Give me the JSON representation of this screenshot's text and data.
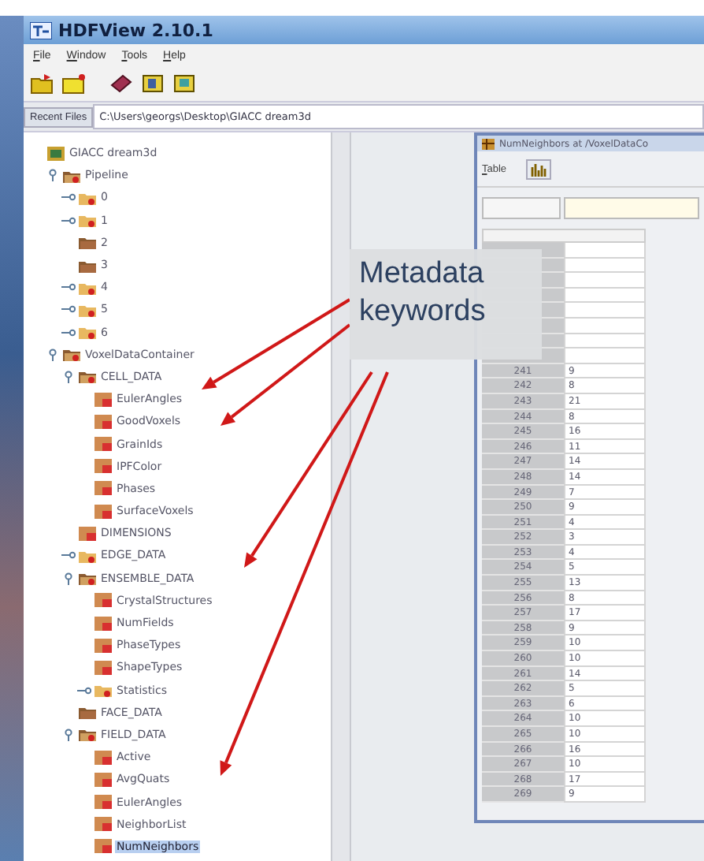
{
  "window": {
    "title": "HDFView 2.10.1"
  },
  "menu": [
    "File",
    "Window",
    "Tools",
    "Help"
  ],
  "recent_files": {
    "label": "Recent Files",
    "value": "C:\\Users\\georgs\\Desktop\\GIACC dream3d"
  },
  "tree": [
    {
      "label": "GIACC dream3d",
      "kind": "file",
      "selected": false,
      "children": [
        {
          "label": "Pipeline",
          "kind": "group",
          "expanded": true,
          "selected": false,
          "children": [
            {
              "label": "0",
              "kind": "group",
              "expanded": false,
              "selected": false
            },
            {
              "label": "1",
              "kind": "group",
              "expanded": false,
              "selected": false
            },
            {
              "label": "2",
              "kind": "empty_group",
              "selected": false
            },
            {
              "label": "3",
              "kind": "empty_group",
              "selected": false
            },
            {
              "label": "4",
              "kind": "group",
              "expanded": false,
              "selected": false
            },
            {
              "label": "5",
              "kind": "group",
              "expanded": false,
              "selected": false
            },
            {
              "label": "6",
              "kind": "group",
              "expanded": false,
              "selected": false
            }
          ]
        },
        {
          "label": "VoxelDataContainer",
          "kind": "group",
          "expanded": true,
          "selected": false,
          "children": [
            {
              "label": "CELL_DATA",
              "kind": "group",
              "expanded": true,
              "selected": false,
              "children": [
                {
                  "label": "EulerAngles",
                  "kind": "dataset",
                  "selected": false
                },
                {
                  "label": "GoodVoxels",
                  "kind": "dataset",
                  "selected": false
                },
                {
                  "label": "GrainIds",
                  "kind": "dataset",
                  "selected": false
                },
                {
                  "label": "IPFColor",
                  "kind": "dataset",
                  "selected": false
                },
                {
                  "label": "Phases",
                  "kind": "dataset",
                  "selected": false
                },
                {
                  "label": "SurfaceVoxels",
                  "kind": "dataset",
                  "selected": false
                }
              ]
            },
            {
              "label": "DIMENSIONS",
              "kind": "dataset",
              "selected": false
            },
            {
              "label": "EDGE_DATA",
              "kind": "group",
              "expanded": false,
              "selected": false
            },
            {
              "label": "ENSEMBLE_DATA",
              "kind": "group",
              "expanded": true,
              "selected": false,
              "children": [
                {
                  "label": "CrystalStructures",
                  "kind": "dataset",
                  "selected": false
                },
                {
                  "label": "NumFields",
                  "kind": "dataset",
                  "selected": false
                },
                {
                  "label": "PhaseTypes",
                  "kind": "dataset",
                  "selected": false
                },
                {
                  "label": "ShapeTypes",
                  "kind": "dataset",
                  "selected": false
                },
                {
                  "label": "Statistics",
                  "kind": "group",
                  "expanded": false,
                  "selected": false
                }
              ]
            },
            {
              "label": "FACE_DATA",
              "kind": "empty_group",
              "selected": false
            },
            {
              "label": "FIELD_DATA",
              "kind": "group",
              "expanded": true,
              "selected": false,
              "children": [
                {
                  "label": "Active",
                  "kind": "dataset",
                  "selected": false
                },
                {
                  "label": "AvgQuats",
                  "kind": "dataset",
                  "selected": false
                },
                {
                  "label": "EulerAngles",
                  "kind": "dataset",
                  "selected": false
                },
                {
                  "label": "NeighborList",
                  "kind": "dataset",
                  "selected": false
                },
                {
                  "label": "NumNeighbors",
                  "kind": "dataset",
                  "selected": true
                }
              ]
            }
          ]
        }
      ]
    }
  ],
  "table_window": {
    "title": "NumNeighbors  at  /VoxelDataCo",
    "menu": [
      "Table"
    ],
    "rows": [
      {
        "index": "241",
        "value": "9"
      },
      {
        "index": "242",
        "value": "8"
      },
      {
        "index": "243",
        "value": "21"
      },
      {
        "index": "244",
        "value": "8"
      },
      {
        "index": "245",
        "value": "16"
      },
      {
        "index": "246",
        "value": "11"
      },
      {
        "index": "247",
        "value": "14"
      },
      {
        "index": "248",
        "value": "14"
      },
      {
        "index": "249",
        "value": "7"
      },
      {
        "index": "250",
        "value": "9"
      },
      {
        "index": "251",
        "value": "4"
      },
      {
        "index": "252",
        "value": "3"
      },
      {
        "index": "253",
        "value": "4"
      },
      {
        "index": "254",
        "value": "5"
      },
      {
        "index": "255",
        "value": "13"
      },
      {
        "index": "256",
        "value": "8"
      },
      {
        "index": "257",
        "value": "17"
      },
      {
        "index": "258",
        "value": "9"
      },
      {
        "index": "259",
        "value": "10"
      },
      {
        "index": "260",
        "value": "10"
      },
      {
        "index": "261",
        "value": "14"
      },
      {
        "index": "262",
        "value": "5"
      },
      {
        "index": "263",
        "value": "6"
      },
      {
        "index": "264",
        "value": "10"
      },
      {
        "index": "265",
        "value": "10"
      },
      {
        "index": "266",
        "value": "16"
      },
      {
        "index": "267",
        "value": "10"
      },
      {
        "index": "268",
        "value": "17"
      },
      {
        "index": "269",
        "value": "9"
      }
    ]
  },
  "callout": {
    "text": "Metadata keywords"
  }
}
